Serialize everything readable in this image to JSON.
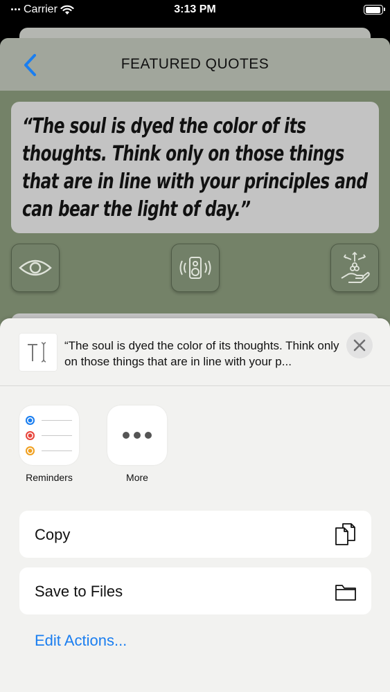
{
  "status_bar": {
    "carrier": "Carrier",
    "time": "3:13 PM",
    "battery_level": 0.95
  },
  "app": {
    "title": "FEATURED QUOTES",
    "back_icon": "chevron-left-icon",
    "quote": "“The soul is dyed the color of its thoughts. Think only on those things that are in line with your principles and can bear the light of day.”",
    "actions": [
      "eye-icon",
      "speaker-icon",
      "share-hand-icon"
    ],
    "colors": {
      "background": "#748268",
      "header": "#a1a69c",
      "card": "#c3c3c3",
      "accent": "#1a7ef0"
    }
  },
  "share_sheet": {
    "preview_text": "“The soul is dyed the color of its thoughts. Think only on those things that are in line with your p...",
    "preview_icon": "text-cursor-icon",
    "close_icon": "close-icon",
    "apps": [
      {
        "label": "Reminders",
        "icon": "reminders-icon"
      },
      {
        "label": "More",
        "icon": "more-icon"
      }
    ],
    "actions": [
      {
        "label": "Copy",
        "icon": "copy-icon"
      },
      {
        "label": "Save to Files",
        "icon": "folder-icon"
      }
    ],
    "edit_actions": "Edit Actions..."
  }
}
